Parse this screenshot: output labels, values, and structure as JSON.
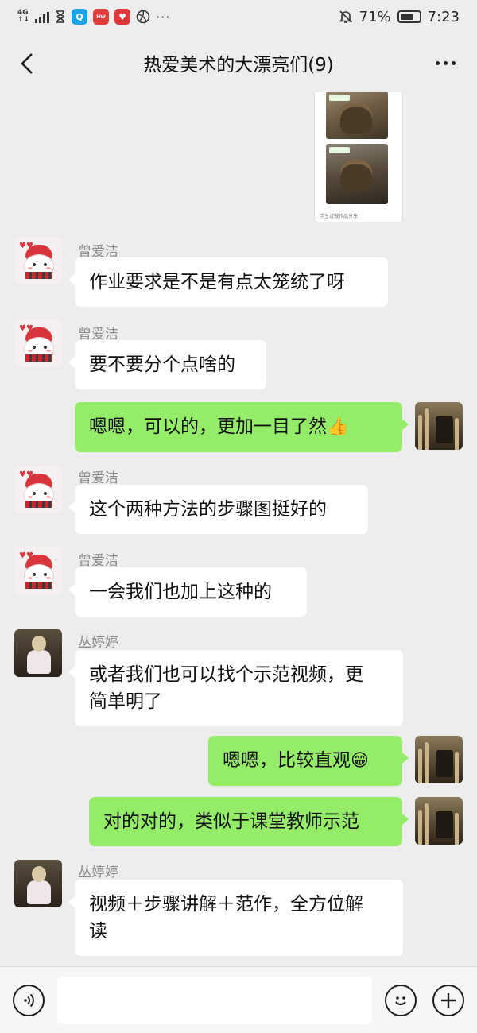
{
  "status_bar": {
    "network": "4G",
    "battery": "71%",
    "battery_level": 0.71,
    "time": "7:23",
    "more_dots": "···"
  },
  "header": {
    "title": "热爱美术的大漂亮们(9)"
  },
  "chat": {
    "image_caption": "学生试做作品分享",
    "messages": [
      {
        "sender": "曾爱洁",
        "text": "作业要求是不是有点太笼统了呀"
      },
      {
        "sender": "曾爱洁",
        "text": "要不要分个点啥的"
      },
      {
        "sender": "",
        "text": "嗯嗯，可以的，更加一目了然",
        "emoji": "👍"
      },
      {
        "sender": "曾爱洁",
        "text": "这个两种方法的步骤图挺好的"
      },
      {
        "sender": "曾爱洁",
        "text": "一会我们也加上这种的"
      },
      {
        "sender": "丛婷婷",
        "text_line1": "或者我们也可以找个示范视频，更",
        "text_line2": "简单明了"
      },
      {
        "sender": "",
        "text": "嗯嗯，比较直观",
        "emoji": "😁"
      },
      {
        "sender": "",
        "text": "对的对的，类似于课堂教师示范"
      },
      {
        "sender": "丛婷婷",
        "text_line1": "视频＋步骤讲解＋范作，全方位解",
        "text_line2": "读"
      }
    ]
  },
  "input_bar": {
    "value": "",
    "voice_icon": "voice-icon",
    "emoji_icon": "emoji-icon",
    "plus_icon": "plus-icon"
  }
}
